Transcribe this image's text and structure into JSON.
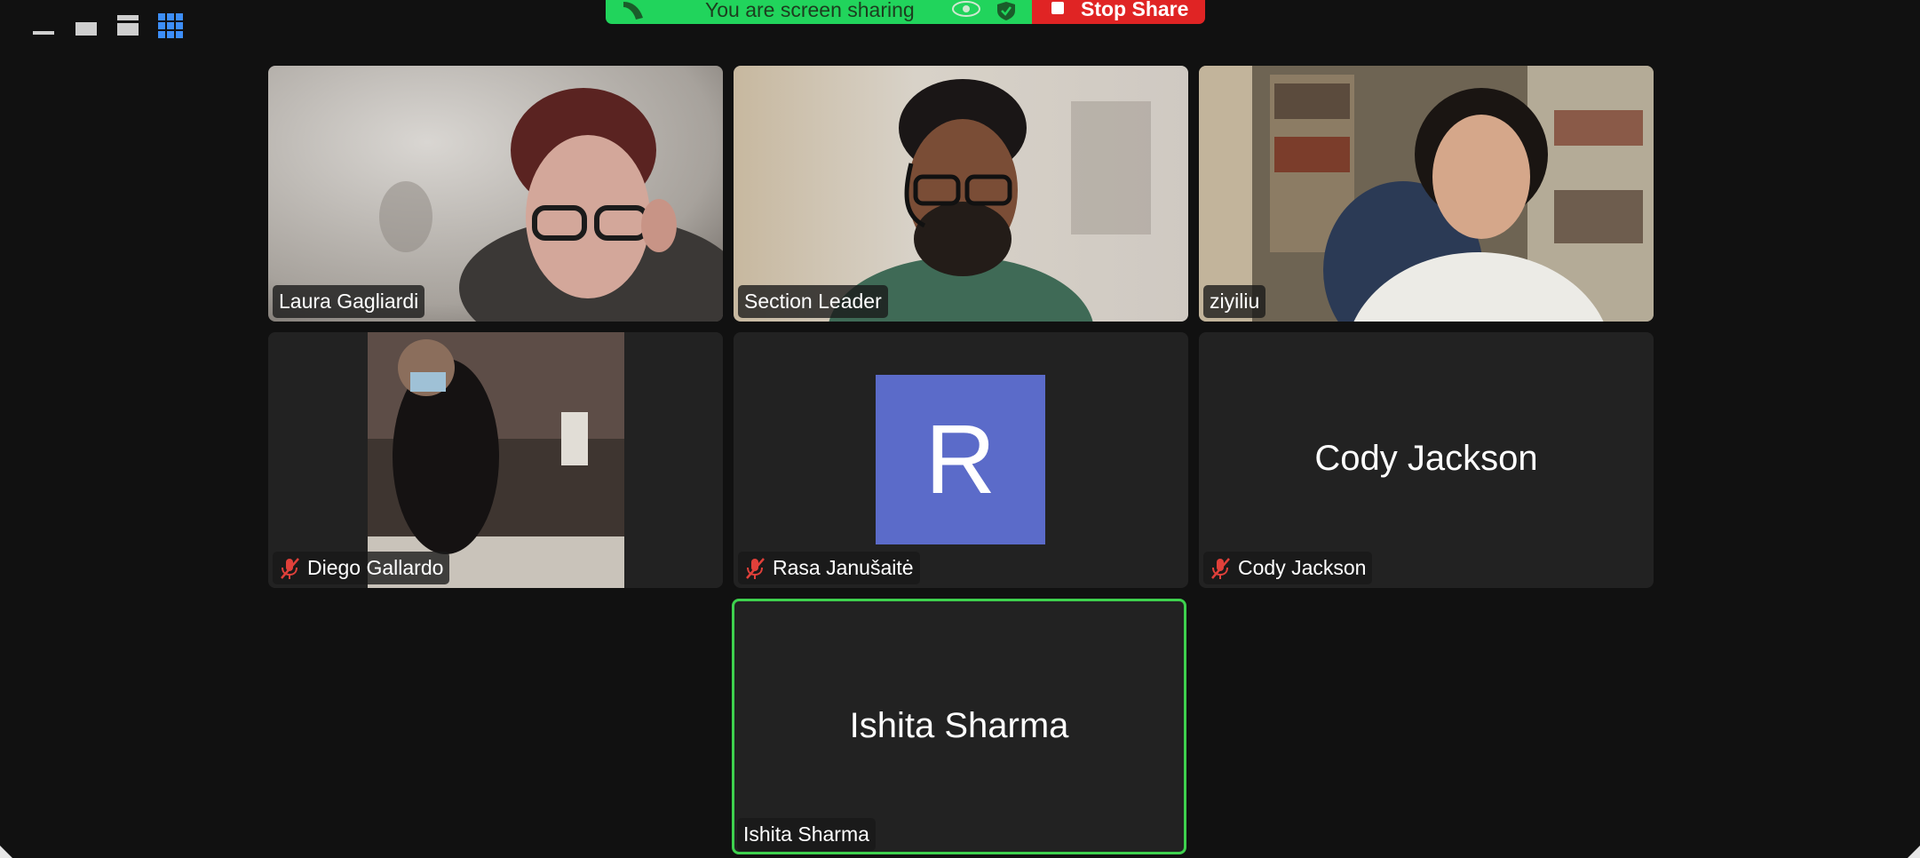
{
  "view_controls": [
    {
      "icon": "minimize-icon"
    },
    {
      "icon": "speaker-view-icon"
    },
    {
      "icon": "strip-view-icon"
    },
    {
      "icon": "gallery-view-icon",
      "active": true,
      "color": "#3d8ef8"
    }
  ],
  "share_banner": {
    "status_text": "You are screen sharing",
    "stop_label": "Stop Share",
    "green": "#21d45c",
    "red": "#e02424"
  },
  "participants": [
    {
      "name": "Laura Gagliardi",
      "muted": false,
      "video": true
    },
    {
      "name": "Section Leader",
      "muted": false,
      "video": true
    },
    {
      "name": "ziyiliu",
      "muted": false,
      "video": true
    },
    {
      "name": "Diego Gallardo",
      "muted": true,
      "video": true
    },
    {
      "name": "Rasa Janušaitė",
      "muted": true,
      "video": false,
      "avatar_letter": "R"
    },
    {
      "name": "Cody Jackson",
      "muted": true,
      "video": false,
      "display_name": "Cody Jackson"
    },
    {
      "name": "Ishita Sharma",
      "muted": false,
      "video": false,
      "display_name": "Ishita Sharma",
      "active_speaker": true
    }
  ],
  "colors": {
    "background": "#111111",
    "tile": "#222222",
    "active_border": "#3ed14e",
    "muted_icon": "#e0403a"
  }
}
